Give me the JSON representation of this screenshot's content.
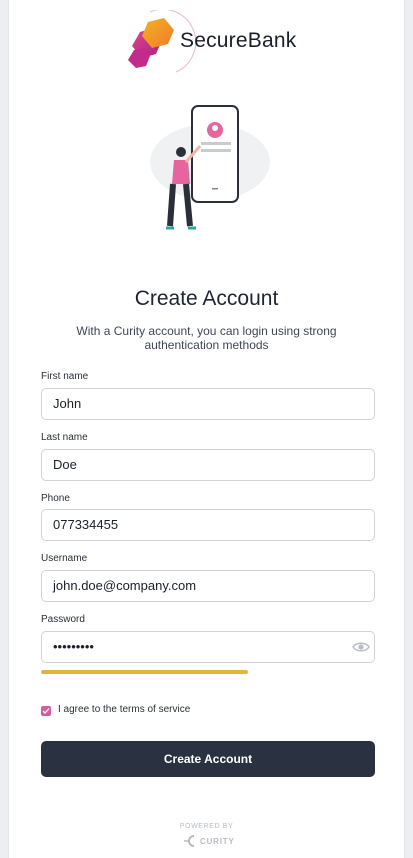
{
  "brand": {
    "name": "SecureBank"
  },
  "header": {
    "title": "Create Account",
    "subtitle": "With a Curity account, you can login using strong authentication methods"
  },
  "form": {
    "first_name": {
      "label": "First name",
      "value": "John"
    },
    "last_name": {
      "label": "Last name",
      "value": "Doe"
    },
    "phone": {
      "label": "Phone",
      "value": "077334455"
    },
    "username": {
      "label": "Username",
      "value": "john.doe@company.com"
    },
    "password": {
      "label": "Password",
      "value": "•••••••••",
      "strength": 0.62
    },
    "terms": {
      "label": "I agree to the terms of service",
      "checked": true
    },
    "submit_label": "Create Account"
  },
  "footer": {
    "powered_by": "POWERED BY",
    "vendor": "CURITY"
  },
  "colors": {
    "accent": "#d65c9a",
    "button": "#2a3242",
    "strength": "#e1b43a"
  },
  "icons": [
    "securebank-logo-icon",
    "phone-illustration",
    "eye-icon",
    "checkmark-icon",
    "curity-logo-icon"
  ]
}
